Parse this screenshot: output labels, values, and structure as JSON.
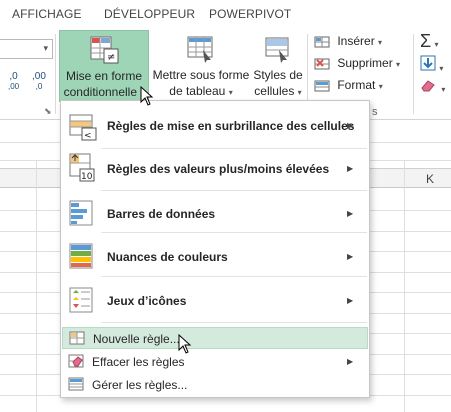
{
  "tabs": [
    "AFFICHAGE",
    "DÉVELOPPEUR",
    "POWERPIVOT"
  ],
  "ribbon": {
    "number_format": {
      "decimal_increase": ",0",
      "decimal_increase_more": ",00",
      "decimal_decrease": ",00",
      "decimal_decrease_less": ",0"
    },
    "styles": {
      "conditional_formatting": {
        "line1": "Mise en forme",
        "line2": "conditionnelle"
      },
      "format_as_table": {
        "line1": "Mettre sous forme",
        "line2": "de tableau"
      },
      "cell_styles": {
        "line1": "Styles de",
        "line2": "cellules"
      }
    },
    "cells": {
      "insert": "Insérer",
      "delete": "Supprimer",
      "format": "Format"
    },
    "cells_group_label": "s",
    "editing": {
      "sum_icon": "sigma-icon",
      "fill_icon": "fill-down-icon",
      "clear_icon": "eraser-icon"
    }
  },
  "sheet": {
    "column_k": "K"
  },
  "menu": {
    "items": [
      {
        "label": "Règles de mise en surbrillance des cellules",
        "icon": "highlight-cells-rules-icon",
        "submenu": true
      },
      {
        "label": "Règles des valeurs plus/moins élevées",
        "icon": "top-bottom-rules-icon",
        "submenu": true
      },
      {
        "label": "Barres de données",
        "icon": "data-bars-icon",
        "submenu": true
      },
      {
        "label": "Nuances de couleurs",
        "icon": "color-scales-icon",
        "submenu": true
      },
      {
        "label": "Jeux d’icônes",
        "icon": "icon-sets-icon",
        "submenu": true
      }
    ],
    "small_items": [
      {
        "label": "Nouvelle règle...",
        "icon": "new-rule-icon",
        "submenu": false
      },
      {
        "label": "Effacer les règles",
        "icon": "clear-rules-icon",
        "submenu": true
      },
      {
        "label": "Gérer les règles...",
        "icon": "manage-rules-icon",
        "submenu": false
      }
    ]
  },
  "colors": {
    "highlight": "#9fd5b7",
    "menu_hover": "#d4eadd",
    "accent_blue": "#2e75b6"
  }
}
